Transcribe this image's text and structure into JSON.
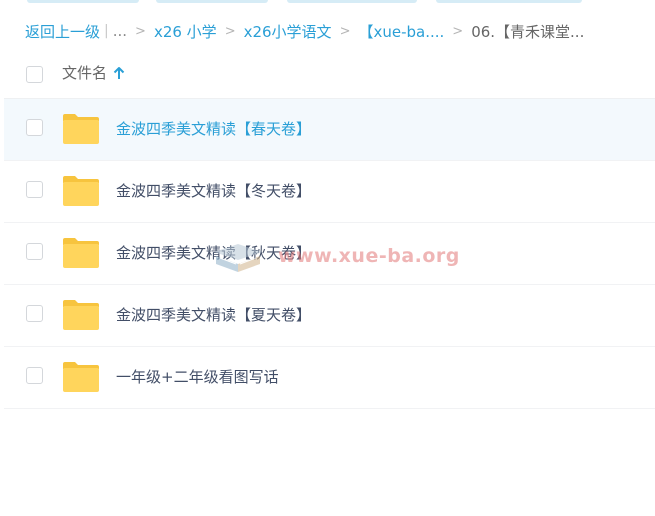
{
  "breadcrumb": {
    "back_label": "返回上一级",
    "pipe": "|",
    "ellipsis": "...",
    "separator": ">",
    "items": [
      {
        "label": "x26 小学"
      },
      {
        "label": "x26小学语文"
      },
      {
        "label": "【xue-ba...."
      },
      {
        "label": "06.【青禾课堂..."
      }
    ]
  },
  "list_header": {
    "column_title": "文件名",
    "sort_direction": "ascending",
    "sort_icon": "arrow-up-icon"
  },
  "files": [
    {
      "name": "金波四季美文精读【春天卷】",
      "type": "folder",
      "selected": true
    },
    {
      "name": "金波四季美文精读【冬天卷】",
      "type": "folder",
      "selected": false
    },
    {
      "name": "金波四季美文精读【秋天卷】",
      "type": "folder",
      "selected": false
    },
    {
      "name": "金波四季美文精读【夏天卷】",
      "type": "folder",
      "selected": false
    },
    {
      "name": "一年级+二年级看图写话",
      "type": "folder",
      "selected": false
    }
  ],
  "watermark": {
    "text": "www.xue-ba.org"
  },
  "colors": {
    "accent": "#2a9fd6",
    "folder": "#ffd55c",
    "folder_tab": "#f7c43e",
    "selected_row_bg": "#f3f9fd",
    "text": "#424e67"
  }
}
